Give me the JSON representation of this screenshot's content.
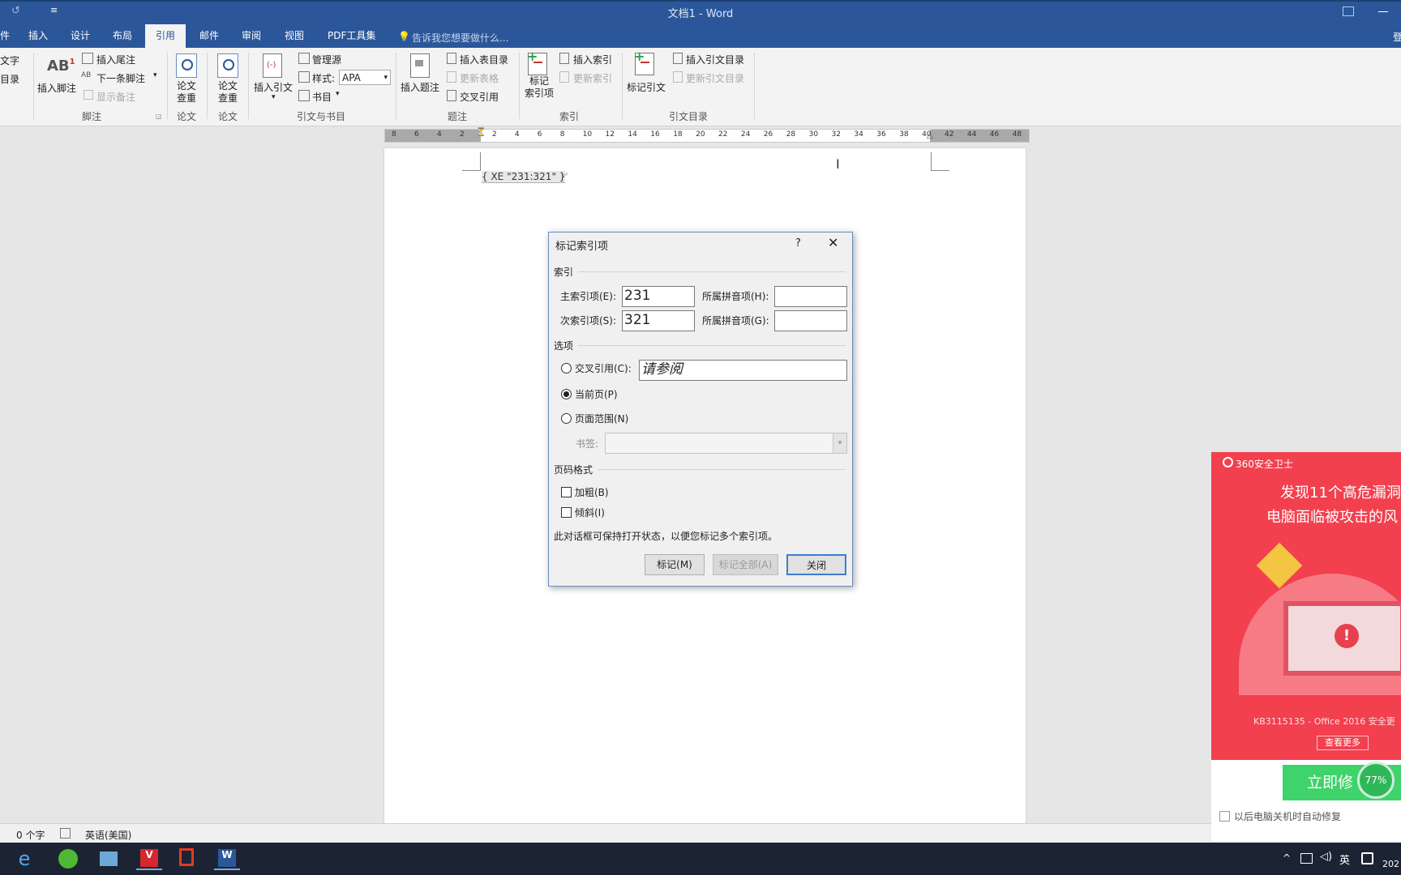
{
  "window": {
    "title": "文档1 - Word"
  },
  "tabs": [
    "插入",
    "设计",
    "布局",
    "引用",
    "邮件",
    "审阅",
    "视图",
    "PDF工具集"
  ],
  "tabs_partial_left": "件",
  "tell_me": "告诉我您想要做什么...",
  "right_partial": "登",
  "ribbon": {
    "left_partial_1": "文字",
    "left_partial_2": "目录",
    "insert_footnote": "插入脚注",
    "insert_endnote": "插入尾注",
    "next_footnote": "下一条脚注",
    "show_notes": "显示备注",
    "group_footnote": "脚注",
    "paper_check_1": "论文\n查重",
    "paper_check_2": "论文\n查重",
    "group_paper_1": "论文",
    "group_paper_2": "论文",
    "insert_citation": "插入引文",
    "manage_sources": "管理源",
    "style_label": "样式:",
    "style_value": "APA",
    "bibliography": "书目",
    "group_citations": "引文与书目",
    "insert_caption": "插入题注",
    "insert_table_of_figures": "插入表目录",
    "update_table": "更新表格",
    "cross_reference": "交叉引用",
    "group_captions": "题注",
    "mark_entry": "标记\n索引项",
    "insert_index": "插入索引",
    "update_index": "更新索引",
    "group_index": "索引",
    "mark_citation": "标记引文",
    "insert_toa": "插入引文目录",
    "update_toa": "更新引文目录",
    "group_toa": "引文目录"
  },
  "ruler": {
    "numbers": [
      "8",
      "6",
      "4",
      "2",
      "2",
      "4",
      "6",
      "8",
      "10",
      "12",
      "14",
      "16",
      "18",
      "20",
      "22",
      "24",
      "26",
      "28",
      "30",
      "32",
      "34",
      "36",
      "38",
      "40",
      "42",
      "44",
      "46",
      "48"
    ]
  },
  "document": {
    "field_code": "{ XE \"231:321\" }"
  },
  "dialog": {
    "title": "标记索引项",
    "help": "?",
    "section_index": "索引",
    "main_entry_label": "主索引项(E):",
    "main_entry_value": "231",
    "main_pinyin_label": "所属拼音项(H):",
    "main_pinyin_value": "",
    "sub_entry_label": "次索引项(S):",
    "sub_entry_value": "321",
    "sub_pinyin_label": "所属拼音项(G):",
    "sub_pinyin_value": "",
    "section_options": "选项",
    "cross_ref_label": "交叉引用(C):",
    "cross_ref_value": "请参阅",
    "current_page_label": "当前页(P)",
    "page_range_label": "页面范围(N)",
    "bookmark_label": "书签:",
    "section_page_format": "页码格式",
    "bold_label": "加粗(B)",
    "italic_label": "倾斜(I)",
    "note": "此对话框可保持打开状态，以便您标记多个索引项。",
    "mark_button": "标记(M)",
    "mark_all_button": "标记全部(A)",
    "close_button": "关闭",
    "selected_option": "current_page"
  },
  "status": {
    "word_count": "0 个字",
    "language": "英语(美国)"
  },
  "popup": {
    "brand": "360安全卫士",
    "headline_1": "发现11个高危漏洞",
    "headline_2": "电脑面临被攻击的风",
    "kb": "KB3115135 - Office 2016 安全更",
    "more": "查看更多",
    "fix_button": "立即修",
    "progress": "77%",
    "auto_fix": "以后电脑关机时自动修复"
  },
  "taskbar": {
    "ime": "英",
    "clock_partial": "202"
  },
  "colors": {
    "word_blue": "#2b579a",
    "popup_red": "#f2404f",
    "fix_green": "#3fd36b"
  }
}
